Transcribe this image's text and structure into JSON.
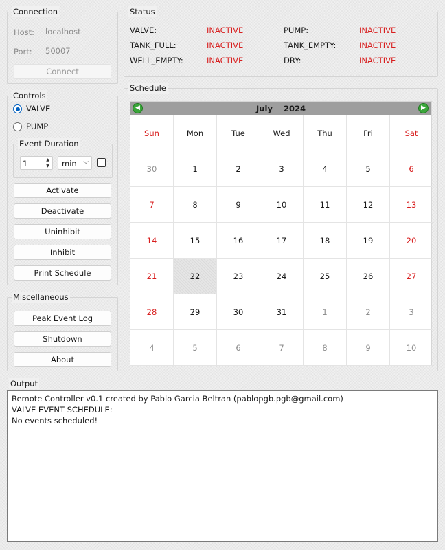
{
  "connection": {
    "title": "Connection",
    "host_label": "Host:",
    "host_value": "localhost",
    "port_label": "Port:",
    "port_value": "50007",
    "connect_label": "Connect"
  },
  "status": {
    "title": "Status",
    "items": [
      {
        "key": "VALVE:",
        "value": "INACTIVE"
      },
      {
        "key": "PUMP:",
        "value": "INACTIVE"
      },
      {
        "key": "TANK_FULL:",
        "value": "INACTIVE"
      },
      {
        "key": "TANK_EMPTY:",
        "value": "INACTIVE"
      },
      {
        "key": "WELL_EMPTY:",
        "value": "INACTIVE"
      },
      {
        "key": "DRY:",
        "value": "INACTIVE"
      }
    ],
    "inactive_color": "#d81e1e"
  },
  "controls": {
    "title": "Controls",
    "radio_valve": "VALVE",
    "radio_pump": "PUMP",
    "selected": "VALVE",
    "duration_title": "Event Duration",
    "duration_value": "1",
    "duration_unit": "min",
    "buttons": {
      "activate": "Activate",
      "deactivate": "Deactivate",
      "uninhibit": "Uninhibit",
      "inhibit": "Inhibit",
      "print_schedule": "Print Schedule"
    }
  },
  "misc": {
    "title": "Miscellaneous",
    "buttons": {
      "peak_log": "Peak Event Log",
      "shutdown": "Shutdown",
      "about": "About"
    }
  },
  "schedule": {
    "title": "Schedule",
    "month": "July",
    "year": "2024",
    "weekdays": [
      "Sun",
      "Mon",
      "Tue",
      "Wed",
      "Thu",
      "Fri",
      "Sat"
    ],
    "weeks": [
      [
        "30",
        "1",
        "2",
        "3",
        "4",
        "5",
        "6"
      ],
      [
        "7",
        "8",
        "9",
        "10",
        "11",
        "12",
        "13"
      ],
      [
        "14",
        "15",
        "16",
        "17",
        "18",
        "19",
        "20"
      ],
      [
        "21",
        "22",
        "23",
        "24",
        "25",
        "26",
        "27"
      ],
      [
        "28",
        "29",
        "30",
        "31",
        "1",
        "2",
        "3"
      ],
      [
        "4",
        "5",
        "6",
        "7",
        "8",
        "9",
        "10"
      ]
    ],
    "selected_day": "22",
    "weekend_color": "#d81e1e",
    "nav_color": "#3aa63a"
  },
  "output": {
    "title": "Output",
    "lines": [
      "Remote Controller v0.1 created by Pablo Garcia Beltran (pablopgb.pgb@gmail.com)",
      "VALVE EVENT SCHEDULE:",
      "No events scheduled!"
    ]
  }
}
